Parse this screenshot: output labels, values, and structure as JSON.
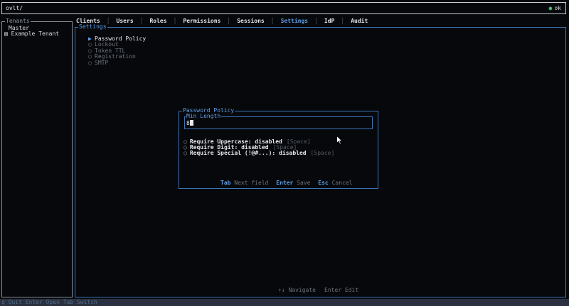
{
  "topbar": {
    "path": "ovlt/",
    "status_dot": "●",
    "status_text": "ok"
  },
  "sidebar": {
    "title": "Tenants",
    "items": [
      {
        "label": "Master"
      },
      {
        "label": "Example Tenant",
        "icon": "▤"
      }
    ]
  },
  "tabs": [
    {
      "label": "Clients"
    },
    {
      "label": "Users"
    },
    {
      "label": "Roles"
    },
    {
      "label": "Permissions"
    },
    {
      "label": "Sessions"
    },
    {
      "label": "Settings",
      "active": true
    },
    {
      "label": "IdP"
    },
    {
      "label": "Audit"
    }
  ],
  "tab_separator": "│",
  "main": {
    "title": "Settings",
    "menu": [
      {
        "label": "Password Policy",
        "bullet": "▶",
        "selected": true
      },
      {
        "label": "Lockout",
        "bullet": "○"
      },
      {
        "label": "Token TTL",
        "bullet": "○"
      },
      {
        "label": "Registration",
        "bullet": "○"
      },
      {
        "label": "SMTP",
        "bullet": "○"
      }
    ]
  },
  "modal": {
    "title": "Password Policy",
    "field": {
      "label": "Min Length",
      "value": "8"
    },
    "options": [
      {
        "circle": "○",
        "label": "Require Uppercase: disabled",
        "hint": "[Space]"
      },
      {
        "circle": "○",
        "label": "Require Digit: disabled",
        "hint": "[Space]"
      },
      {
        "circle": "○",
        "label": "Require Special (!@#...): disabled",
        "hint": "[Space]"
      }
    ],
    "footer": [
      {
        "key": "Tab",
        "desc": "Next field"
      },
      {
        "key": "Enter",
        "desc": "Save"
      },
      {
        "key": "Esc",
        "desc": "Cancel"
      }
    ]
  },
  "nav_hints": {
    "navigate": "↑↓ Navigate",
    "edit": "Enter Edit"
  },
  "bottombar": {
    "text": "q Quit  Enter Open  Tab Switch"
  },
  "colors": {
    "accent": "#5ea0e8",
    "background": "#06080c",
    "ok": "#3fbf6a"
  }
}
